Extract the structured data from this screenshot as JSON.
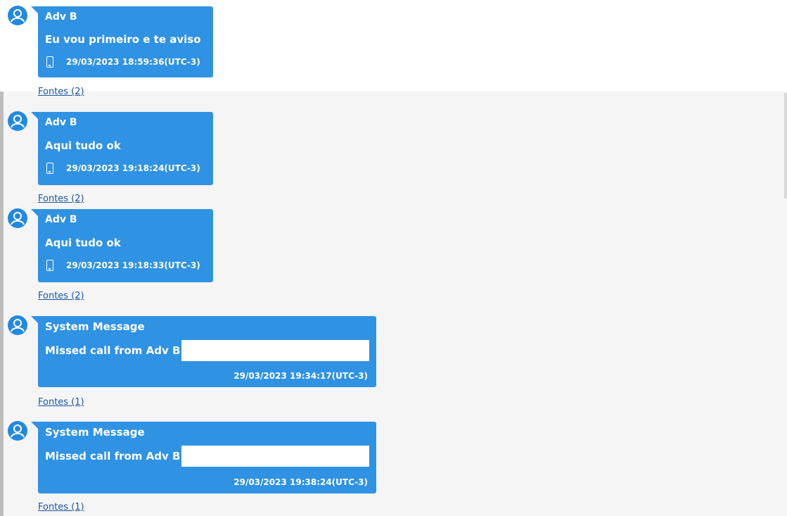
{
  "messages": [
    {
      "sender": "Adv B",
      "text": "Eu vou primeiro e te aviso",
      "timestamp": "29/03/2023 18:59:36(UTC-3)",
      "device_icon": "phone-icon",
      "sources_link": "Fontes (2)"
    },
    {
      "sender": "Adv B",
      "text": "Aqui tudo ok",
      "timestamp": "29/03/2023 19:18:24(UTC-3)",
      "device_icon": "phone-icon",
      "sources_link": "Fontes (2)"
    },
    {
      "sender": "Adv B",
      "text": "Aqui tudo ok",
      "timestamp": "29/03/2023 19:18:33(UTC-3)",
      "device_icon": "phone-icon",
      "sources_link": "Fontes (2)"
    },
    {
      "sender": "System Message",
      "text": "Missed call from Adv B",
      "timestamp": "29/03/2023 19:34:17(UTC-3)",
      "sources_link": "Fontes (1)"
    },
    {
      "sender": "System Message",
      "text": "Missed call from Adv B",
      "timestamp": "29/03/2023 19:38:24(UTC-3)",
      "sources_link": "Fontes (1)"
    }
  ],
  "colors": {
    "bubble": "#2f92e3",
    "avatar": "#2289e0",
    "link": "#1a56a8"
  },
  "avatar_icon": "user-avatar-icon"
}
